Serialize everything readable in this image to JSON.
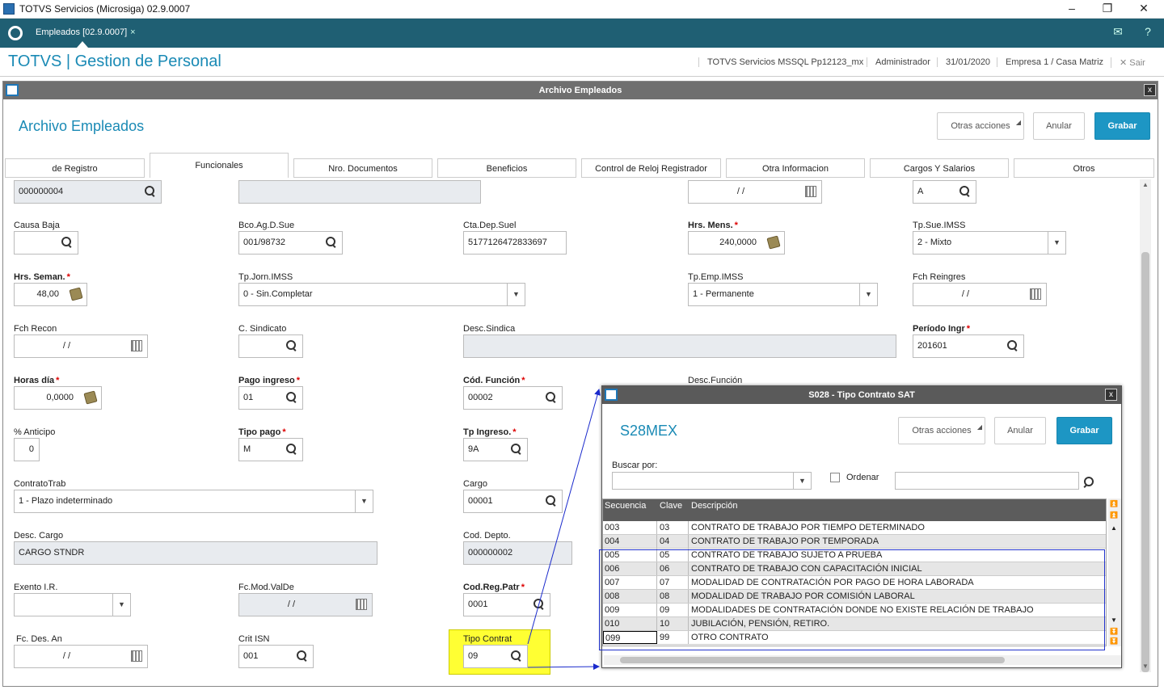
{
  "window": {
    "title": "TOTVS Servicios (Microsiga) 02.9.0007",
    "minimize": "–",
    "maximize": "❐",
    "close": "✕"
  },
  "appbar": {
    "tab_label": "Empleados [02.9.0007]",
    "tab_close": "×",
    "mail": "✉",
    "help": "?"
  },
  "header": {
    "brand": "TOTVS | Gestion de Personal",
    "server": "TOTVS Servicios MSSQL Pp12123_mx",
    "user": "Administrador",
    "date": "31/01/2020",
    "company": "Empresa 1 / Casa Matriz",
    "exit": "Sair",
    "exit_icon": "✕"
  },
  "form": {
    "caption": "Archivo Empleados",
    "title": "Archivo Empleados",
    "btn_other": "Otras acciones",
    "btn_cancel": "Anular",
    "btn_save": "Grabar",
    "close": "x"
  },
  "tabs": [
    "de Registro",
    "Funcionales",
    "Nro. Documentos",
    "Beneficios",
    "Control de Reloj Registrador",
    "Otra Informacion",
    "Cargos Y Salarios",
    "Otros"
  ],
  "active_tab": "Funcionales",
  "fields": {
    "r0_a": "000000004",
    "r0_date": " /  /",
    "r0_c": "A",
    "causa_baja": {
      "label": "Causa Baja",
      "value": ""
    },
    "bco": {
      "label": "Bco.Ag.D.Sue",
      "value": "001/98732"
    },
    "cta": {
      "label": "Cta.Dep.Suel",
      "value": "5177126472833697"
    },
    "hrs_mens": {
      "label": "Hrs. Mens.",
      "value": "240,0000"
    },
    "tp_sue": {
      "label": "Tp.Sue.IMSS",
      "value": "2 -  Mixto"
    },
    "hrs_seman": {
      "label": "Hrs. Seman.",
      "value": "48,00"
    },
    "tp_jorn": {
      "label": "Tp.Jorn.IMSS",
      "value": "0 - Sin.Completar"
    },
    "tp_emp": {
      "label": "Tp.Emp.IMSS",
      "value": "1 -  Permanente"
    },
    "fch_reingres": {
      "label": "Fch Reingres",
      "value": " /  /"
    },
    "fch_recon": {
      "label": "Fch Recon",
      "value": " /  /"
    },
    "c_sindicato": {
      "label": "C. Sindicato",
      "value": ""
    },
    "desc_sindica": {
      "label": "Desc.Sindica",
      "value": ""
    },
    "periodo": {
      "label": "Período Ingr",
      "value": "201601"
    },
    "horas_dia": {
      "label": "Horas día",
      "value": "0,0000"
    },
    "pago_ingreso": {
      "label": "Pago ingreso",
      "value": "01"
    },
    "cod_funcion": {
      "label": "Cód. Función",
      "value": "00002"
    },
    "desc_funcion": {
      "label": "Desc.Función"
    },
    "anticipo": {
      "label": "% Anticipo",
      "value": "0"
    },
    "tipo_pago": {
      "label": "Tipo pago",
      "value": "M"
    },
    "tp_ingreso": {
      "label": "Tp Ingreso.",
      "value": "9A"
    },
    "contrato": {
      "label": "ContratoTrab",
      "value": "1 - Plazo indeterminado"
    },
    "cargo": {
      "label": "Cargo",
      "value": "00001"
    },
    "desc_cargo": {
      "label": "Desc. Cargo",
      "value": "CARGO STNDR"
    },
    "cod_depto": {
      "label": "Cod. Depto.",
      "value": "000000002"
    },
    "exento": {
      "label": "Exento I.R.",
      "value": ""
    },
    "fc_mod": {
      "label": "Fc.Mod.ValDe",
      "value": " /  /"
    },
    "cod_reg": {
      "label": "Cod.Reg.Patr",
      "value": "0001"
    },
    "fc_des": {
      "label": "Fc. Des. An",
      "value": " /  /"
    },
    "crit_isn": {
      "label": "Crit ISN",
      "value": "001"
    },
    "tipo_contrat": {
      "label": "Tipo Contrat",
      "value": "09"
    }
  },
  "dialog": {
    "caption": "S028 - Tipo Contrato SAT",
    "title": "S28MEX",
    "btn_other": "Otras acciones",
    "btn_cancel": "Anular",
    "btn_save": "Grabar",
    "close": "x",
    "search_label": "Buscar por:",
    "order_label": "Ordenar",
    "columns": [
      "Secuencia",
      "Clave",
      "Descripción"
    ],
    "rows": [
      [
        "003",
        "03",
        "CONTRATO DE TRABAJO POR TIEMPO DETERMINADO"
      ],
      [
        "004",
        "04",
        "CONTRATO DE TRABAJO POR TEMPORADA"
      ],
      [
        "005",
        "05",
        "CONTRATO DE TRABAJO SUJETO A PRUEBA"
      ],
      [
        "006",
        "06",
        "CONTRATO DE TRABAJO CON CAPACITACIÓN INICIAL"
      ],
      [
        "007",
        "07",
        "MODALIDAD DE CONTRATACIÓN POR PAGO DE HORA LABORADA"
      ],
      [
        "008",
        "08",
        "MODALIDAD DE TRABAJO POR COMISIÓN LABORAL"
      ],
      [
        "009",
        "09",
        "MODALIDADES DE CONTRATACIÓN DONDE NO EXISTE RELACIÓN DE TRABAJO"
      ],
      [
        "010",
        "10",
        "JUBILACIÓN, PENSIÓN, RETIRO."
      ],
      [
        "099",
        "99",
        "OTRO CONTRATO"
      ]
    ]
  },
  "colors": {
    "teal": "#1f5f73",
    "accent": "#1a8ab5",
    "primary_btn": "#1d96c4",
    "highlight": "#ffff33",
    "annotation": "#2233cc",
    "required": "#dd0000"
  }
}
